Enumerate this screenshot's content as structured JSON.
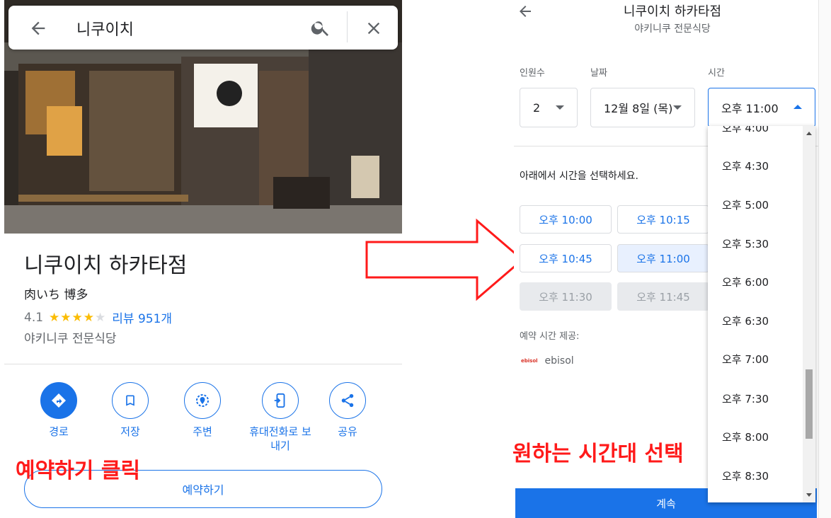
{
  "left": {
    "search": {
      "query": "니쿠이치"
    },
    "place": {
      "name": "니쿠이치 하카타점",
      "subtitle": "肉いち 博多",
      "rating": "4.1",
      "stars_filled": 4,
      "reviews": "리뷰 951개",
      "category": "야키니쿠 전문식당"
    },
    "actions": [
      {
        "label": "경로",
        "icon": "directions-icon"
      },
      {
        "label": "저장",
        "icon": "bookmark-icon"
      },
      {
        "label": "주변",
        "icon": "nearby-icon"
      },
      {
        "label": "휴대전화로 보\n내기",
        "icon": "send-to-phone-icon"
      },
      {
        "label": "공유",
        "icon": "share-icon"
      }
    ],
    "reserve_button": "예약하기",
    "annotation": "예약하기 클릭"
  },
  "right": {
    "title": "니쿠이치 하카타점",
    "subtitle": "야키니쿠 전문식당",
    "party_label": "인원수",
    "party_value": "2",
    "date_label": "날짜",
    "date_value": "12월 8일 (목)",
    "time_label": "시간",
    "time_value": "오후 11:00",
    "choose_text": "아래에서 시간을 선택하세요.",
    "slots": [
      {
        "label": "오후 10:00",
        "state": "available"
      },
      {
        "label": "오후 10:15",
        "state": "available"
      },
      {
        "label": "오후 10:45",
        "state": "available"
      },
      {
        "label": "오후 11:00",
        "state": "selected"
      },
      {
        "label": "오후 11:30",
        "state": "disabled"
      },
      {
        "label": "오후 11:45",
        "state": "disabled"
      }
    ],
    "provided_by": "예약 시간 제공:",
    "provider": "ebisol",
    "provider_logo": "ebisol",
    "continue_button": "계속",
    "annotation": "원하는 시간대 선택"
  },
  "dropdown": {
    "options": [
      "오후 4:00",
      "오후 4:30",
      "오후 5:00",
      "오후 5:30",
      "오후 6:00",
      "오후 6:30",
      "오후 7:00",
      "오후 7:30",
      "오후 8:00",
      "오후 8:30"
    ]
  },
  "colors": {
    "accent": "#1a73e8",
    "annotation": "#ff1a1a",
    "star": "#fbbc04"
  }
}
